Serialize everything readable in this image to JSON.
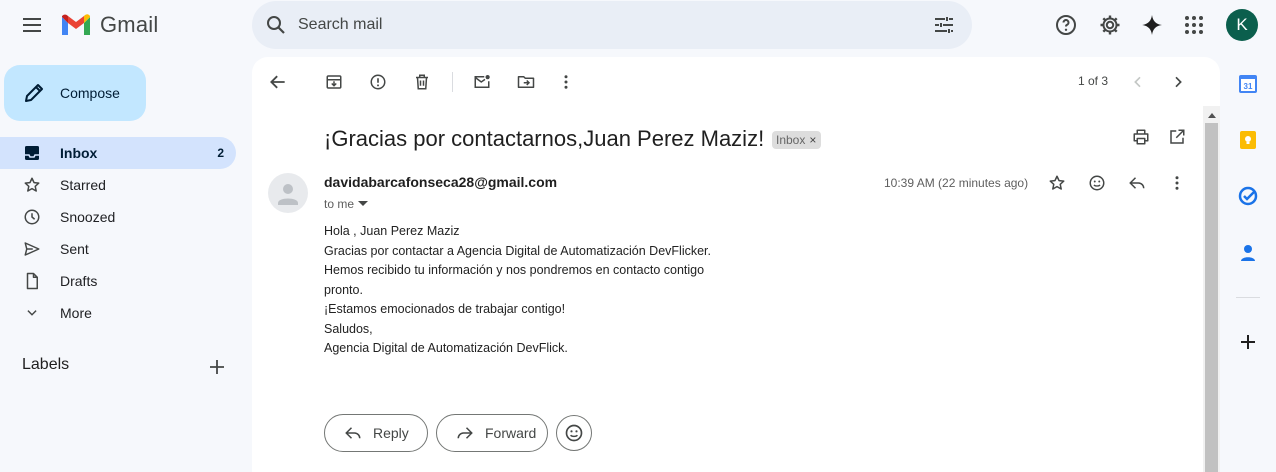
{
  "header": {
    "app_name": "Gmail",
    "search_placeholder": "Search mail",
    "avatar_initial": "K"
  },
  "sidebar": {
    "compose_label": "Compose",
    "items": [
      {
        "label": "Inbox",
        "count": "2",
        "icon": "inbox-icon",
        "active": true
      },
      {
        "label": "Starred",
        "count": "",
        "icon": "star-icon"
      },
      {
        "label": "Snoozed",
        "count": "",
        "icon": "clock-icon"
      },
      {
        "label": "Sent",
        "count": "",
        "icon": "send-icon"
      },
      {
        "label": "Drafts",
        "count": "",
        "icon": "draft-icon"
      },
      {
        "label": "More",
        "count": "",
        "icon": "chevron-down-icon"
      }
    ],
    "labels_title": "Labels"
  },
  "toolbar": {
    "pagination": "1 of 3"
  },
  "message": {
    "subject": "¡Gracias por contactarnos,Juan Perez Maziz!",
    "label_badge": "Inbox",
    "badge_close": "×",
    "sender": "davidabarcafonseca28@gmail.com",
    "to": "to me",
    "timestamp": "10:39 AM (22 minutes ago)",
    "body": [
      "Hola ,  Juan Perez Maziz",
      "Gracias por contactar a Agencia Digital de Automatización DevFlicker.",
      "Hemos recibido tu información y nos pondremos en contacto contigo",
      "pronto.",
      "¡Estamos emocionados de trabajar contigo!",
      "Saludos,",
      "Agencia Digital de Automatización DevFlick."
    ]
  },
  "actions": {
    "reply_label": "Reply",
    "forward_label": "Forward"
  },
  "colors": {
    "background": "#f6f8fc",
    "compose_bg": "#c2e7ff",
    "active_nav": "#d3e3fd",
    "avatar_bg": "#0b5f4d"
  }
}
